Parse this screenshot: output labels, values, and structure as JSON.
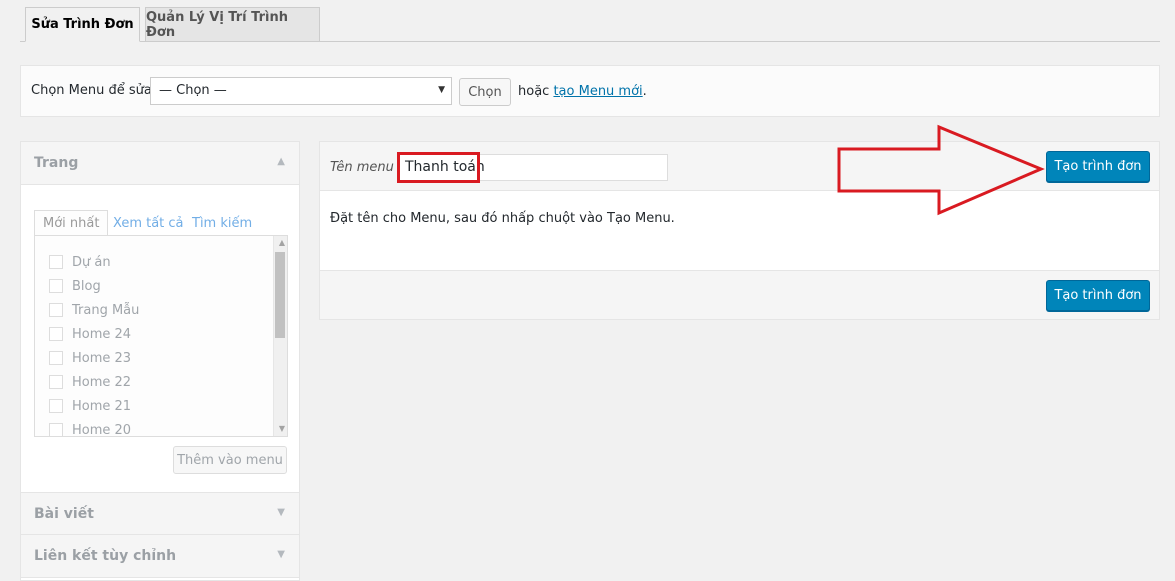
{
  "tabs": [
    {
      "label": "Sửa Trình Đơn",
      "active": true
    },
    {
      "label": "Quản Lý Vị Trí Trình Đơn",
      "active": false
    }
  ],
  "manage": {
    "label": "Chọn Menu để sửa:",
    "select_value": "— Chọn —",
    "select_button": "Chọn",
    "or_text": "hoặc ",
    "create_link": "tạo Menu mới",
    "period": "."
  },
  "left": {
    "pages_title": "Trang",
    "inner_tabs": [
      "Mới nhất",
      "Xem tất cả",
      "Tìm kiếm"
    ],
    "items": [
      "Dự án",
      "Blog",
      "Trang Mẫu",
      "Home 24",
      "Home 23",
      "Home 22",
      "Home 21",
      "Home 20"
    ],
    "add_button": "Thêm vào menu",
    "posts_title": "Bài viết",
    "custom_links_title": "Liên kết tùy chỉnh"
  },
  "right": {
    "name_label": "Tên menu",
    "name_value": "Thanh toán",
    "create_button": "Tạo trình đơn",
    "description": "Đặt tên cho Menu, sau đó nhấp chuột vào Tạo Menu.",
    "footer_button": "Tạo trình đơn"
  },
  "colors": {
    "primary": "#0085ba",
    "highlight": "#d91a21"
  }
}
